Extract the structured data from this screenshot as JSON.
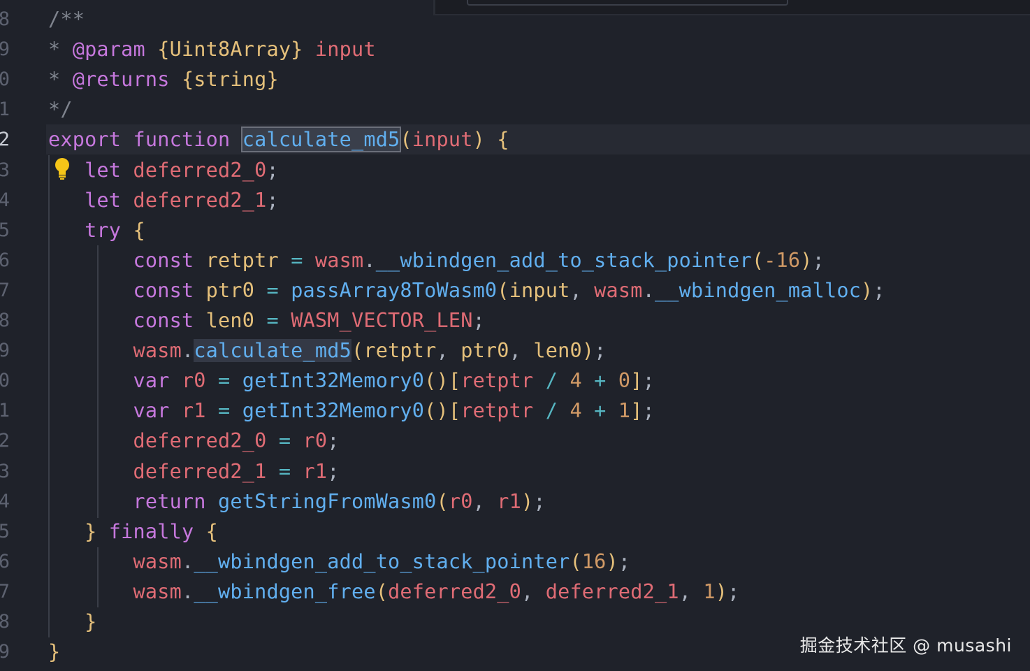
{
  "editor": {
    "language": "javascript",
    "theme_colors": {
      "background": "#1f222a",
      "keyword": "#c678dd",
      "function": "#61afef",
      "variable": "#e06c75",
      "type": "#e5c07b",
      "number": "#d19a66",
      "comment": "#7f848e"
    },
    "gutter_line_numbers": [
      "8",
      "9",
      "0",
      "1",
      "2",
      "3",
      "4",
      "5",
      "6",
      "7",
      "8",
      "9",
      "0",
      "1",
      "2",
      "3",
      "4",
      "5",
      "6",
      "7",
      "8",
      "9"
    ],
    "active_line_number": "2",
    "code_lines": [
      "/**",
      " * @param {Uint8Array} input",
      " * @returns {string}",
      " */",
      "export function calculate_md5(input) {",
      "    let deferred2_0;",
      "    let deferred2_1;",
      "    try {",
      "        const retptr = wasm.__wbindgen_add_to_stack_pointer(-16);",
      "        const ptr0 = passArray8ToWasm0(input, wasm.__wbindgen_malloc);",
      "        const len0 = WASM_VECTOR_LEN;",
      "        wasm.calculate_md5(retptr, ptr0, len0);",
      "        var r0 = getInt32Memory0()[retptr / 4 + 0];",
      "        var r1 = getInt32Memory0()[retptr / 4 + 1];",
      "        deferred2_0 = r0;",
      "        deferred2_1 = r1;",
      "        return getStringFromWasm0(r0, r1);",
      "    } finally {",
      "        wasm.__wbindgen_add_to_stack_pointer(16);",
      "        wasm.__wbindgen_free(deferred2_0, deferred2_1, 1);",
      "    }",
      "}"
    ],
    "highlighted_symbol": "calculate_md5",
    "lightbulb_icon": "lightbulb-icon"
  },
  "watermark": {
    "text": "掘金技术社区 @ musashi"
  }
}
